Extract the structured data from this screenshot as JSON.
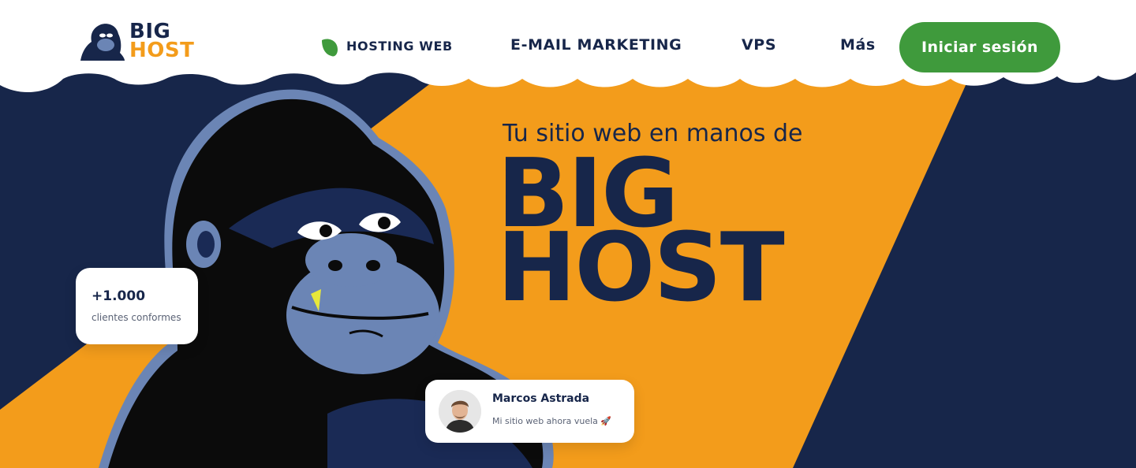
{
  "brand": {
    "line1": "BIG",
    "line2": "HOST"
  },
  "nav": {
    "items": [
      {
        "label": "HOSTING WEB"
      },
      {
        "label": "E-MAIL MARKETING"
      },
      {
        "label": "VPS"
      },
      {
        "label": "Más"
      }
    ],
    "login_label": "Iniciar sesión"
  },
  "hero": {
    "subtitle": "Tu sitio web en manos de",
    "headline_line1": "BIG",
    "headline_line2": "HOST"
  },
  "stat": {
    "value": "+1.000",
    "label": "clientes conformes"
  },
  "review": {
    "name": "Marcos Astrada",
    "text": "Mi sitio web ahora vuela 🚀"
  },
  "colors": {
    "navy": "#17264a",
    "orange": "#f39c1b",
    "green": "#3f9a3c",
    "gorilla_blue": "#6b85b5"
  },
  "icons": [
    "leaf-icon",
    "gorilla-logo-icon"
  ]
}
